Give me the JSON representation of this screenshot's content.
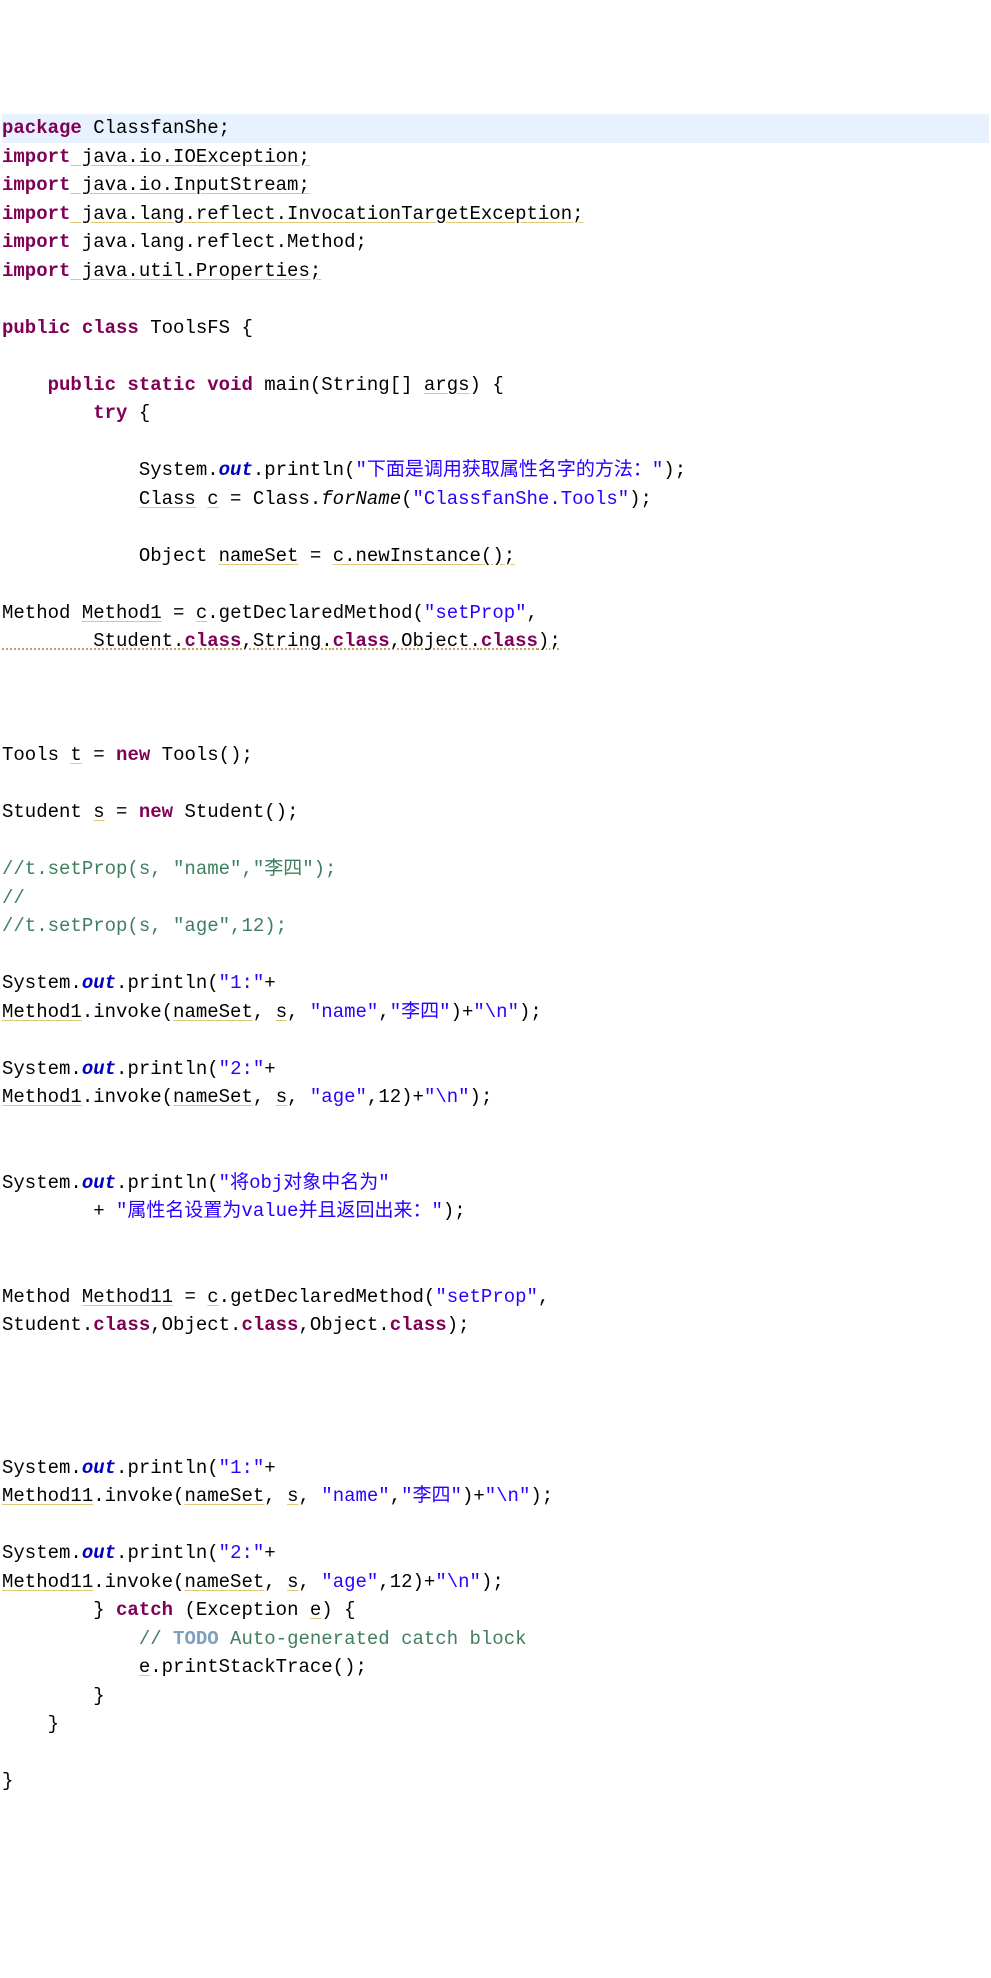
{
  "lines": {
    "l1a": "package",
    "l1b": " ClassfanShe;",
    "l2a": "import",
    "l2b": " java.io.IOException;",
    "l3a": "import",
    "l3b": " java.io.InputStream;",
    "l4a": "import",
    "l4b": " java.lang.reflect.InvocationTargetException;",
    "l5a": "import",
    "l5b": " java.lang.reflect.Method;",
    "l6a": "import",
    "l6b": " java.util.Properties;",
    "l8a": "public",
    "l8b": " class",
    "l8c": " ToolsFS {",
    "l10a": "    public",
    "l10b": " static",
    "l10c": " void",
    "l10d": " main(String[] ",
    "l10e": "args",
    "l10f": ") {",
    "l11a": "        try",
    "l11b": " {",
    "l13a": "            System.",
    "l13b": "out",
    "l13c": ".println(",
    "l13d": "\"下面是调用获取属性名字的方法：\"",
    "l13e": ");",
    "l14a": "            ",
    "l14b": "Class",
    "l14c": " ",
    "l14d": "c",
    "l14e": " = Class.",
    "l14f": "forName",
    "l14g": "(",
    "l14h": "\"ClassfanShe.Tools\"",
    "l14i": ");",
    "l16a": "            Object ",
    "l16b": "nameSet",
    "l16c": " = ",
    "l16d": "c",
    "l16e": ".newInstance();",
    "l18a": "Method ",
    "l18b": "Method1",
    "l18c": " = ",
    "l18d": "c",
    "l18e": ".getDeclaredMethod(",
    "l18f": "\"setProp\"",
    "l18g": ",",
    "l19a": "        Student.",
    "l19b": "class",
    "l19c": ",String.",
    "l19d": "class",
    "l19e": ",Object.",
    "l19f": "class",
    "l19g": ");",
    "l23a": "Tools ",
    "l23b": "t",
    "l23c": " = ",
    "l23d": "new",
    "l23e": " Tools();",
    "l25a": "Student ",
    "l25b": "s",
    "l25c": " = ",
    "l25d": "new",
    "l25e": " Student();",
    "l27": "//t.setProp(s, \"name\",\"李四\");",
    "l28": "//",
    "l29": "//t.setProp(s, \"age\",12);",
    "l31a": "System.",
    "l31b": "out",
    "l31c": ".println(",
    "l31d": "\"1:\"",
    "l31e": "+",
    "l32a": "Method1",
    "l32b": ".invoke(",
    "l32c": "nameSet",
    "l32d": ", ",
    "l32e": "s",
    "l32f": ", ",
    "l32g": "\"name\"",
    "l32h": ",",
    "l32i": "\"李四\"",
    "l32j": ")+",
    "l32k": "\"\\n\"",
    "l32l": ");",
    "l34a": "System.",
    "l34b": "out",
    "l34c": ".println(",
    "l34d": "\"2:\"",
    "l34e": "+",
    "l35a": "Method1",
    "l35b": ".invoke(",
    "l35c": "nameSet",
    "l35d": ", ",
    "l35e": "s",
    "l35f": ", ",
    "l35g": "\"age\"",
    "l35h": ",12)+",
    "l35i": "\"\\n\"",
    "l35j": ");",
    "l38a": "System.",
    "l38b": "out",
    "l38c": ".println(",
    "l38d": "\"将obj对象中名为\"",
    "l39a": "        + ",
    "l39b": "\"属性名设置为value并且返回出来：\"",
    "l39c": ");",
    "l42a": "Method ",
    "l42b": "Method11",
    "l42c": " = ",
    "l42d": "c",
    "l42e": ".getDeclaredMethod(",
    "l42f": "\"setProp\"",
    "l42g": ",",
    "l43a": "Student.",
    "l43b": "class",
    "l43c": ",Object.",
    "l43d": "class",
    "l43e": ",Object.",
    "l43f": "class",
    "l43g": ");",
    "l48a": "System.",
    "l48b": "out",
    "l48c": ".println(",
    "l48d": "\"1:\"",
    "l48e": "+",
    "l49a": "Method11",
    "l49b": ".invoke(",
    "l49c": "nameSet",
    "l49d": ", ",
    "l49e": "s",
    "l49f": ", ",
    "l49g": "\"name\"",
    "l49h": ",",
    "l49i": "\"李四\"",
    "l49j": ")+",
    "l49k": "\"\\n\"",
    "l49l": ");",
    "l51a": "System.",
    "l51b": "out",
    "l51c": ".println(",
    "l51d": "\"2:\"",
    "l51e": "+",
    "l52a": "Method11",
    "l52b": ".invoke(",
    "l52c": "nameSet",
    "l52d": ", ",
    "l52e": "s",
    "l52f": ", ",
    "l52g": "\"age\"",
    "l52h": ",12)+",
    "l52i": "\"\\n\"",
    "l52j": ");",
    "l53a": "        } ",
    "l53b": "catch",
    "l53c": " (Exception ",
    "l53d": "e",
    "l53e": ") {",
    "l54a": "            ",
    "l54b": "// ",
    "l54c": "TODO",
    "l54d": " Auto-generated catch block",
    "l55a": "            ",
    "l55b": "e",
    "l55c": ".printStackTrace();",
    "l56": "        }",
    "l57": "    }",
    "l59": "}"
  }
}
